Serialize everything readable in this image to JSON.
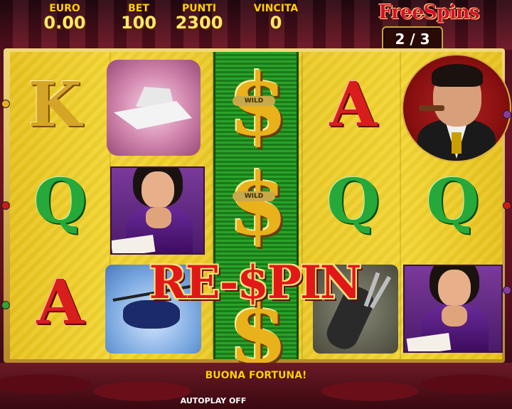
{
  "hud": {
    "euro_label": "EURO",
    "euro_value": "0.00",
    "bet_label": "BET",
    "bet_value": "100",
    "punti_label": "PUNTI",
    "punti_value": "2300",
    "vincita_label": "VINCITA",
    "vincita_value": "0"
  },
  "freespins": {
    "title": "FreeSpins",
    "counter": "2 / 3"
  },
  "reels": {
    "reel1": [
      "K",
      "Q",
      "A"
    ],
    "reel4": [
      "A",
      "Q"
    ],
    "reel5_mid": "Q",
    "wild_tags": [
      "WILD",
      "WILD"
    ],
    "wild_symbol": "$"
  },
  "banner": {
    "respin": "RE-$PIN"
  },
  "status": {
    "message": "BUONA FORTUNA!",
    "autoplay": "AUTOPLAY OFF"
  },
  "colors": {
    "gold": "#ffd200",
    "red": "#d81d1d",
    "green": "#27a83a",
    "reel_bg": "#f3d633"
  }
}
